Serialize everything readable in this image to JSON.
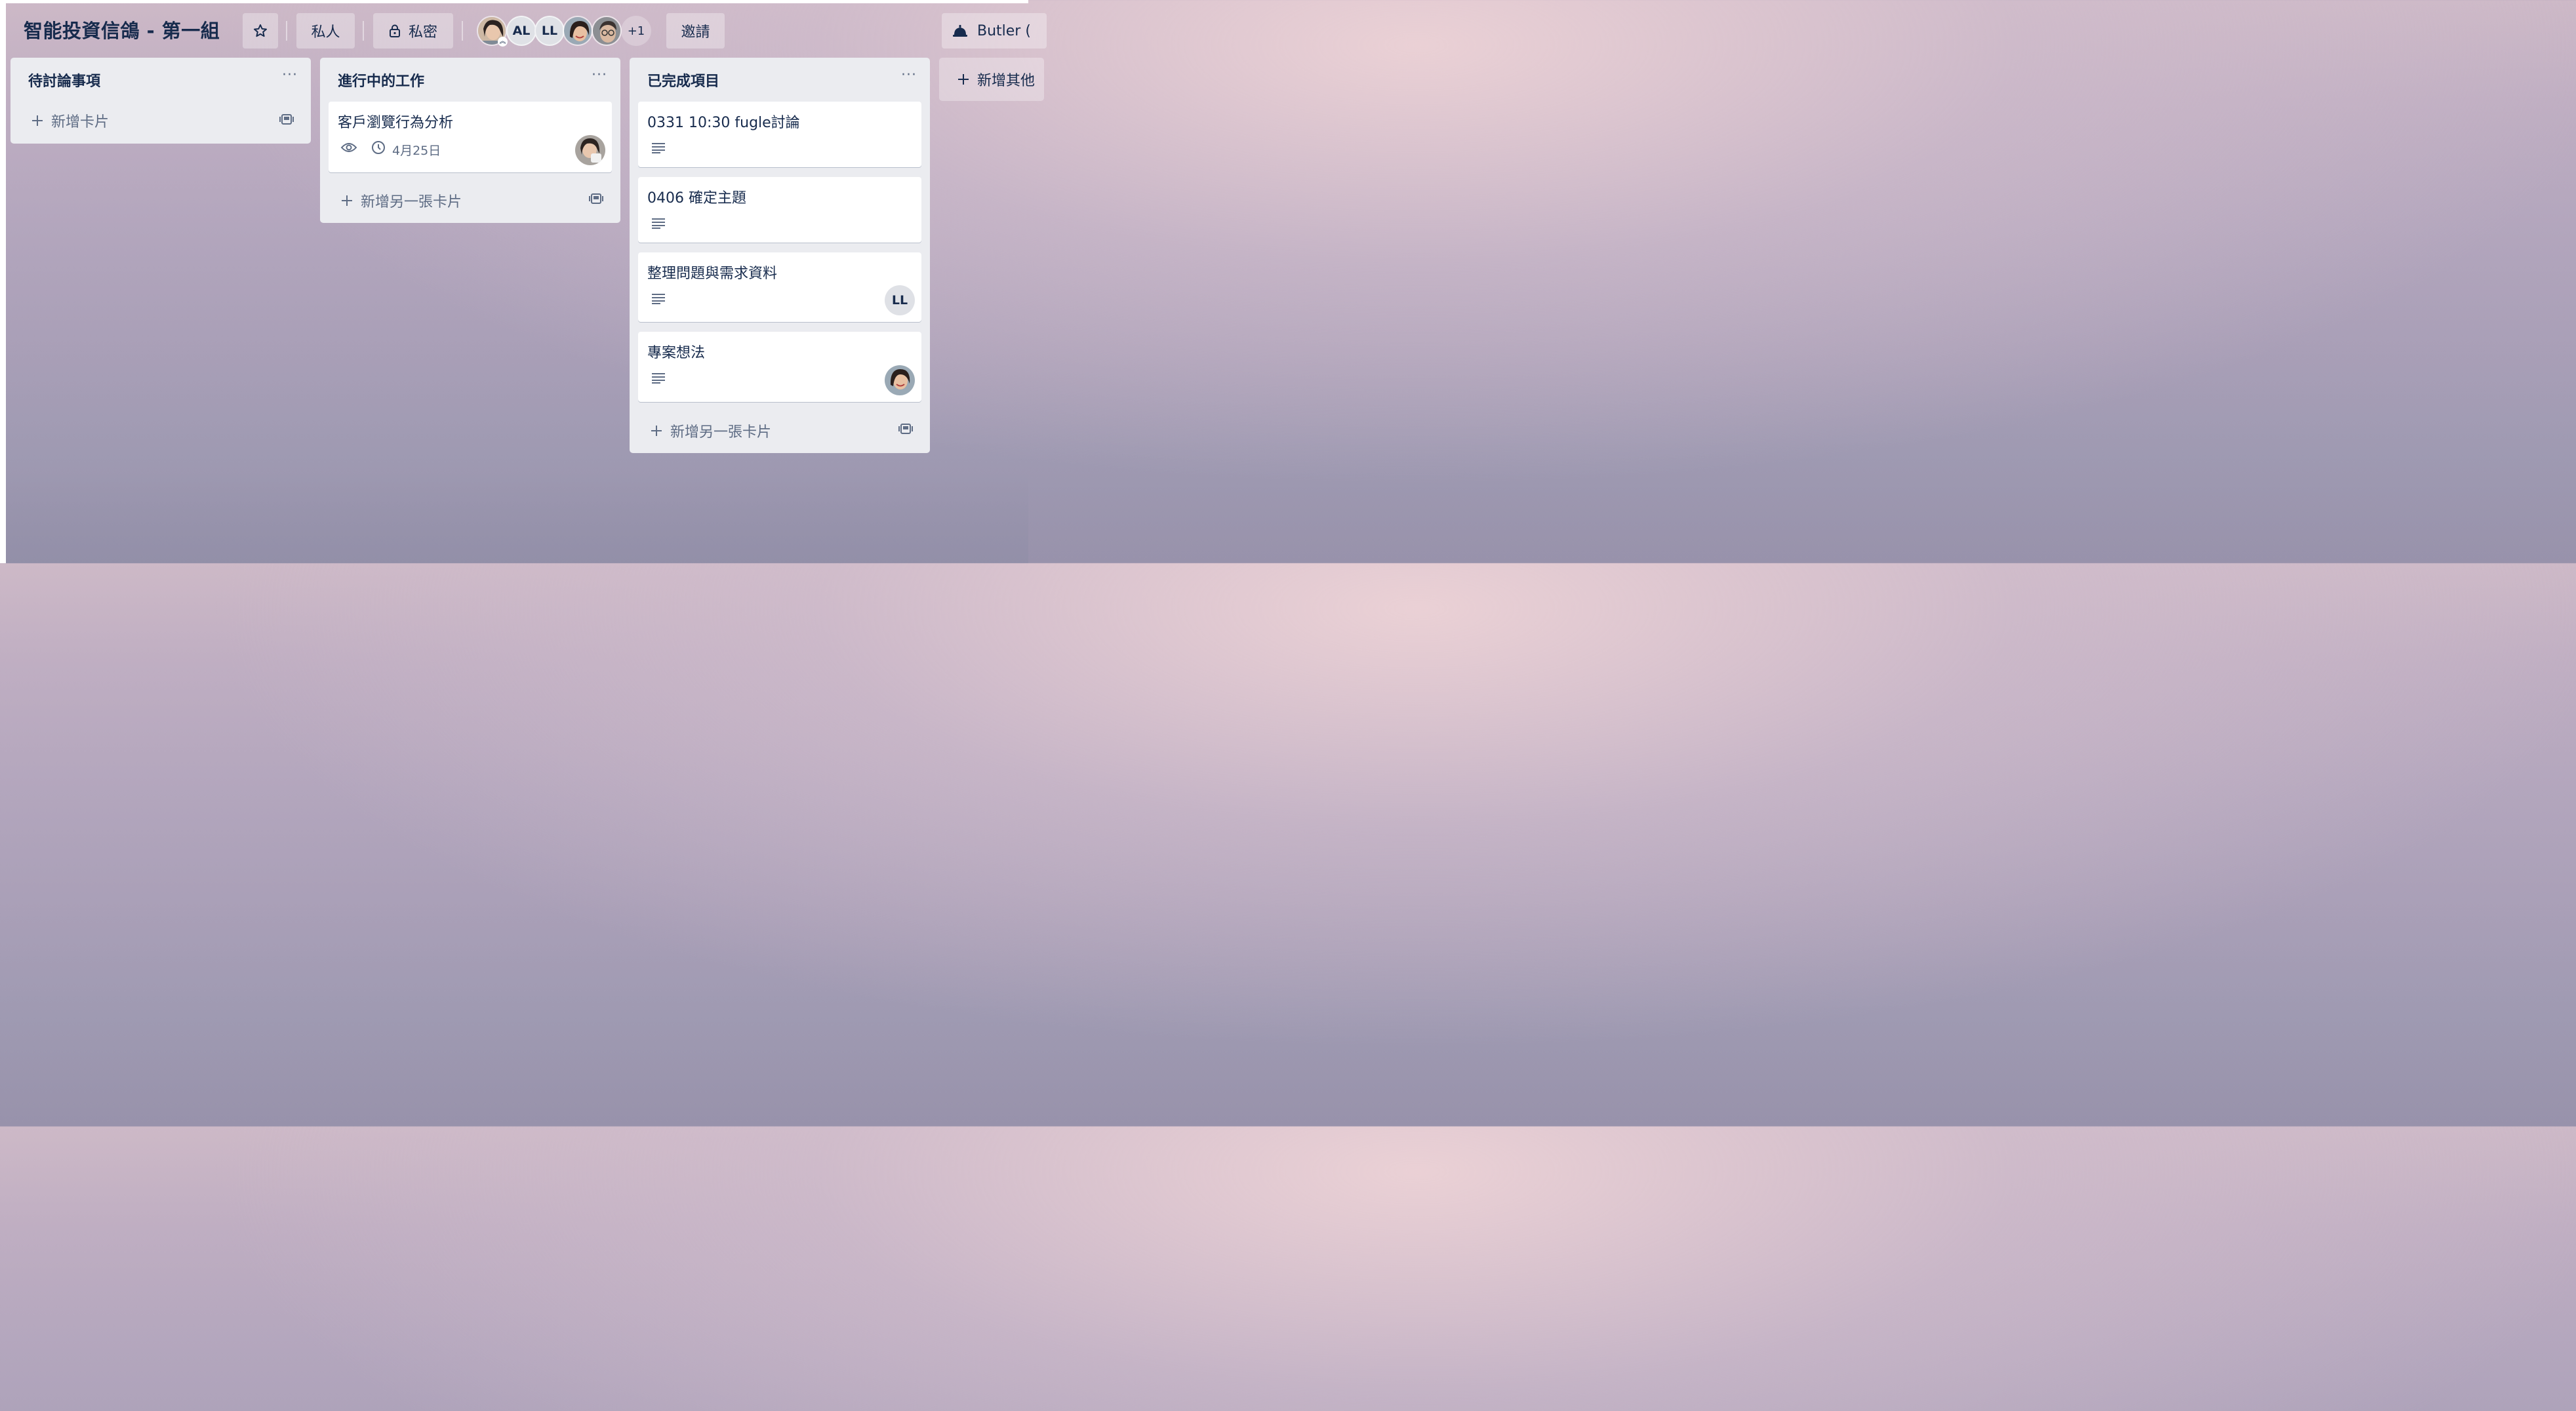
{
  "board": {
    "title": "智能投資信鴿 - 第一組",
    "star_icon": "star-icon",
    "visibility_team_label": "私人",
    "visibility_privacy_label": "私密",
    "lock_icon": "lock-icon",
    "members": [
      {
        "type": "photo",
        "initials": "",
        "is_admin": true
      },
      {
        "type": "initials",
        "initials": "AL"
      },
      {
        "type": "initials",
        "initials": "LL"
      },
      {
        "type": "photo",
        "initials": ""
      },
      {
        "type": "photo",
        "initials": ""
      }
    ],
    "members_more_label": "+1",
    "invite_label": "邀請",
    "butler_label": "Butler (",
    "butler_icon": "bell-icon"
  },
  "lists": [
    {
      "title": "待討論事項",
      "menu_label": "···",
      "add_card_label": "新增卡片",
      "cards": []
    },
    {
      "title": "進行中的工作",
      "menu_label": "···",
      "add_card_label": "新增另一張卡片",
      "cards": [
        {
          "title": "客戶瀏覽行為分析",
          "watching": true,
          "due_date": "4月25日",
          "member": "photo"
        }
      ]
    },
    {
      "title": "已完成項目",
      "menu_label": "···",
      "add_card_label": "新增另一張卡片",
      "cards": [
        {
          "title": "0331 10:30 fugle討論",
          "has_description": true
        },
        {
          "title": "0406 確定主題",
          "has_description": true
        },
        {
          "title": "整理問題與需求資料",
          "has_description": true,
          "member_initials": "LL"
        },
        {
          "title": "專案想法",
          "has_description": true,
          "member": "photo"
        }
      ]
    }
  ],
  "add_list_label": "新增其他",
  "colors": {
    "list_bg": "#ebecf0",
    "text": "#172b4d",
    "muted": "#5e6c84"
  }
}
